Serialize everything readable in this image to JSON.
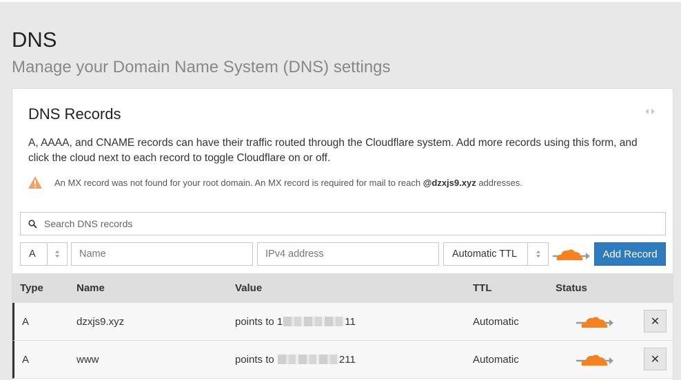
{
  "header": {
    "title": "DNS",
    "subtitle": "Manage your Domain Name System (DNS) settings"
  },
  "card": {
    "title": "DNS Records",
    "description": "A, AAAA, and CNAME records can have their traffic routed through the Cloudflare system. Add more records using this form, and click the cloud next to each record to toggle Cloudflare on or off.",
    "warning": {
      "prefix": "An MX record was not found for your root domain. An MX record is required for mail to reach",
      "domain": "@dzxjs9.xyz",
      "suffix": "addresses."
    }
  },
  "search": {
    "placeholder": "Search DNS records",
    "value": ""
  },
  "form": {
    "type_value": "A",
    "name_placeholder": "Name",
    "value_placeholder": "IPv4 address",
    "ttl_value": "Automatic TTL",
    "add_label": "Add Record"
  },
  "table": {
    "headers": {
      "type": "Type",
      "name": "Name",
      "value": "Value",
      "ttl": "TTL",
      "status": "Status"
    },
    "rows": [
      {
        "type": "A",
        "name": "dzxjs9.xyz",
        "value_prefix": "points to",
        "value_lead": "1",
        "value_tail": "11",
        "ttl": "Automatic",
        "delete_label": "✕"
      },
      {
        "type": "A",
        "name": "www",
        "value_prefix": "points to",
        "value_lead": "",
        "value_tail": "211",
        "ttl": "Automatic",
        "delete_label": "✕"
      }
    ]
  },
  "colors": {
    "accent": "#2f7bbf",
    "cloud": "#f6821f",
    "warning": "#f0a265"
  },
  "icons": {
    "search": "search-icon",
    "warning": "warning-triangle-icon",
    "cloud": "cloudflare-cloud-icon",
    "expand": "expand-arrows-icon",
    "stepper": "updown-stepper-icon",
    "delete": "close-icon"
  }
}
